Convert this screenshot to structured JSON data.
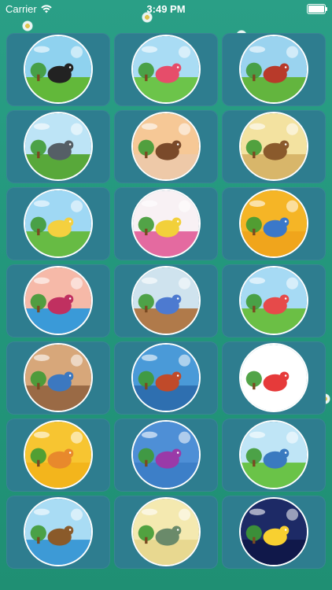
{
  "status_bar": {
    "carrier": "Carrier",
    "time": "3:49 PM"
  },
  "colors": {
    "background": "#23977c",
    "tile": "#2e7d8f",
    "ring": "#ffffff"
  },
  "grid": {
    "tiles": [
      {
        "icon": "black-sheep-icon",
        "sky": "#8fd2ef",
        "ground": "#62b83a",
        "accent": "#222222"
      },
      {
        "icon": "kids-playground-icon",
        "sky": "#a9dcf4",
        "ground": "#6cc44a",
        "accent": "#e64d6a"
      },
      {
        "icon": "farm-barn-icon",
        "sky": "#9ad3ef",
        "ground": "#63b53e",
        "accent": "#b83a2a"
      },
      {
        "icon": "elephant-ride-icon",
        "sky": "#bde4f6",
        "ground": "#58a83a",
        "accent": "#555f66"
      },
      {
        "icon": "monkeys-on-bed-icon",
        "sky": "#f6c896",
        "ground": "#eec9a8",
        "accent": "#7a4a2a"
      },
      {
        "icon": "grandfather-clock-mouse-icon",
        "sky": "#f3e2a0",
        "ground": "#d8b66a",
        "accent": "#8a5a2c"
      },
      {
        "icon": "duck-garden-icon",
        "sky": "#9fd8f4",
        "ground": "#67bb44",
        "accent": "#f4d03f"
      },
      {
        "icon": "teapot-icon",
        "sky": "#f8f1f4",
        "ground": "#e46aa0",
        "accent": "#f2d03a"
      },
      {
        "icon": "kids-waving-icon",
        "sky": "#f5b526",
        "ground": "#f0a51c",
        "accent": "#3a78c9"
      },
      {
        "icon": "itsy-bitsy-spider-icon",
        "sky": "#f6b9a8",
        "ground": "#3a9ad8",
        "accent": "#c03060"
      },
      {
        "icon": "teddy-in-bed-icon",
        "sky": "#cfe3ee",
        "ground": "#b07a4a",
        "accent": "#4d7ad0"
      },
      {
        "icon": "jack-and-jill-icon",
        "sky": "#a6daf4",
        "ground": "#6bbf45",
        "accent": "#e64a4a"
      },
      {
        "icon": "kitchen-kids-icon",
        "sky": "#d7a77a",
        "ground": "#9a6a45",
        "accent": "#3c78c0"
      },
      {
        "icon": "london-bridge-icon",
        "sky": "#4a9ad8",
        "ground": "#2e6fb0",
        "accent": "#c04a2a"
      },
      {
        "icon": "numbers-girl-icon",
        "sky": "#ffffff",
        "ground": "#ffffff",
        "accent": "#e63a3a"
      },
      {
        "icon": "cat-icon",
        "sky": "#f7c531",
        "ground": "#f3b51c",
        "accent": "#e8892c"
      },
      {
        "icon": "umbrella-girl-icon",
        "sky": "#4e8fd6",
        "ground": "#3d7fc8",
        "accent": "#9a3aa8"
      },
      {
        "icon": "kids-park-icon",
        "sky": "#bfe5f6",
        "ground": "#6ac348",
        "accent": "#3a7ac0"
      },
      {
        "icon": "row-boat-icon",
        "sky": "#a9dcf4",
        "ground": "#3d9ad6",
        "accent": "#8a5a2a"
      },
      {
        "icon": "babies-sleeping-icon",
        "sky": "#f4e9b0",
        "ground": "#e8d890",
        "accent": "#6a8a6a"
      },
      {
        "icon": "twinkle-star-icon",
        "sky": "#1d2a66",
        "ground": "#10184a",
        "accent": "#f8d030"
      }
    ]
  }
}
